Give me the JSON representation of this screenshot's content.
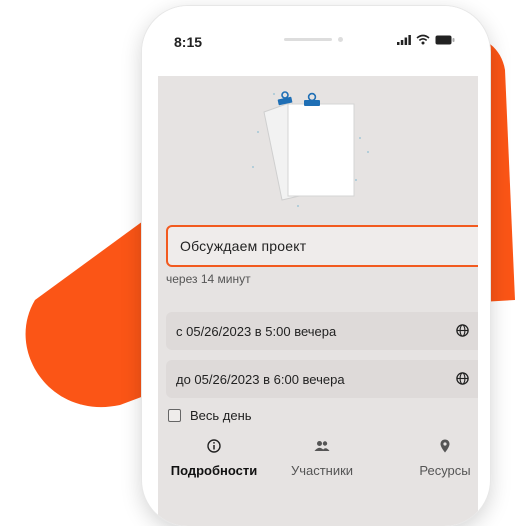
{
  "colors": {
    "accent": "#f25a1f",
    "decor_shape": "#fb5516",
    "screen_background": "#e6e3e2",
    "field_background": "#dedad9",
    "clip_blue": "#1f6fb5"
  },
  "status_bar": {
    "time": "8:15",
    "icons": [
      "signal-icon",
      "wifi-icon",
      "battery-icon"
    ]
  },
  "event": {
    "title": "Обсуждаем проект",
    "starts_in": "через 14 минут",
    "start": "с 05/26/2023 в 5:00 вечера",
    "end": "до 05/26/2023 в 6:00 вечера",
    "timezone_icon": "globe-icon",
    "all_day_label": "Весь день",
    "all_day_checked": false
  },
  "tabs": [
    {
      "label": "Подробности",
      "icon": "info-icon",
      "active": true
    },
    {
      "label": "Участники",
      "icon": "people-icon",
      "active": false
    },
    {
      "label": "Ресурсы",
      "icon": "location-pin-icon",
      "active": false
    }
  ]
}
